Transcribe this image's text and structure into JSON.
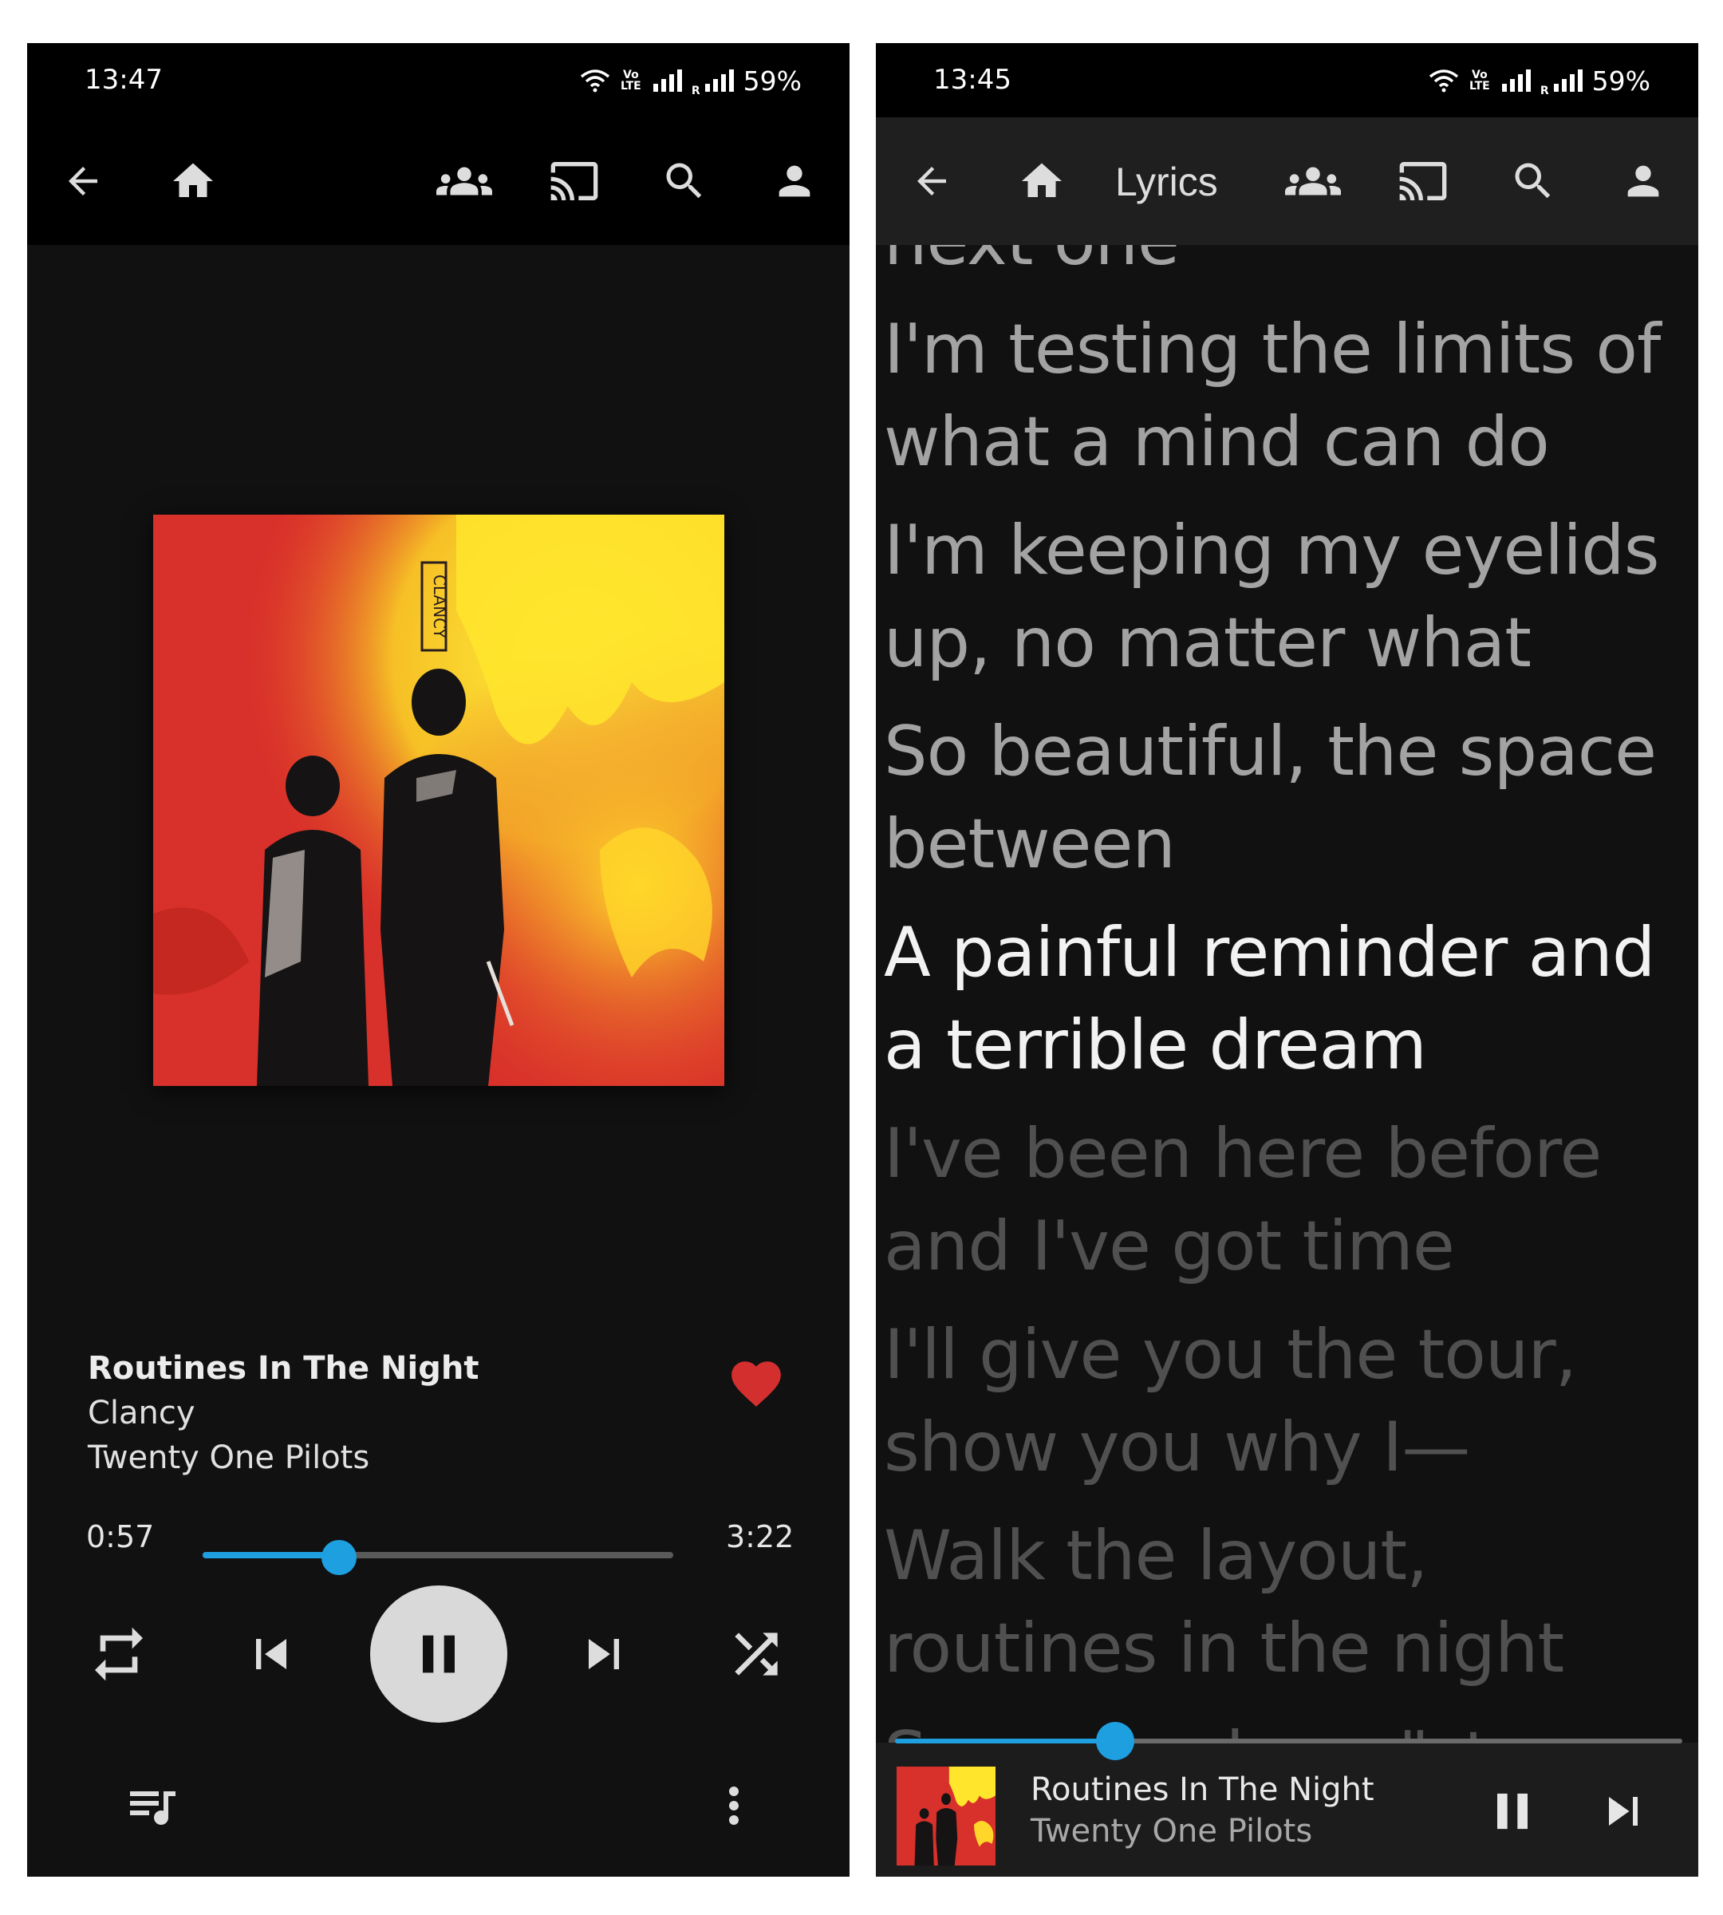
{
  "left_screen": {
    "status": {
      "time": "13:47",
      "battery": "59%",
      "volte_line1": "Vo",
      "volte_line2": "LTE",
      "roaming": "R"
    },
    "appbar": {
      "icons": [
        "back-arrow-icon",
        "home-icon",
        "group-session-icon",
        "cast-icon",
        "search-icon",
        "account-icon"
      ]
    },
    "album_art": {
      "label": "album-cover",
      "vertical_logo": "CLANCY"
    },
    "track": {
      "title": "Routines In The Night",
      "album": "Clancy",
      "artist": "Twenty One Pilots",
      "liked": true,
      "heart_color": "#d32f2f"
    },
    "progress": {
      "current": "0:57",
      "total": "3:22",
      "fraction": 0.29,
      "accent": "#1e9fe0"
    },
    "controls": [
      "repeat-icon",
      "skip-previous-icon",
      "pause-icon",
      "skip-next-icon",
      "shuffle-icon"
    ],
    "bottom_bar": [
      "queue-icon",
      "more-vert-icon"
    ]
  },
  "right_screen": {
    "status": {
      "time": "13:45",
      "battery": "59%",
      "volte_line1": "Vo",
      "volte_line2": "LTE",
      "roaming": "R"
    },
    "appbar": {
      "title": "Lyrics",
      "icons": [
        "back-arrow-icon",
        "home-icon",
        "group-session-icon",
        "cast-icon",
        "search-icon",
        "account-icon"
      ]
    },
    "lyrics": [
      {
        "text": "next one",
        "state": "past"
      },
      {
        "text": "I'm testing the limits of what a mind can do",
        "state": "past"
      },
      {
        "text": "I'm keeping my eyelids up, no matter what",
        "state": "past"
      },
      {
        "text": "So beautiful, the space between",
        "state": "past"
      },
      {
        "text": "A painful reminder and a terrible dream",
        "state": "current"
      },
      {
        "text": "I've been here before and I've got time",
        "state": "future"
      },
      {
        "text": "I'll give you the tour, show you why I—",
        "state": "future"
      },
      {
        "text": "Walk the layout, routines in the night",
        "state": "future"
      },
      {
        "text": "Some are here \"stay",
        "state": "future"
      }
    ],
    "mini_player": {
      "title": "Routines In The Night",
      "artist": "Twenty One Pilots",
      "fraction": 0.28,
      "controls": [
        "pause-icon",
        "skip-next-icon"
      ]
    }
  }
}
